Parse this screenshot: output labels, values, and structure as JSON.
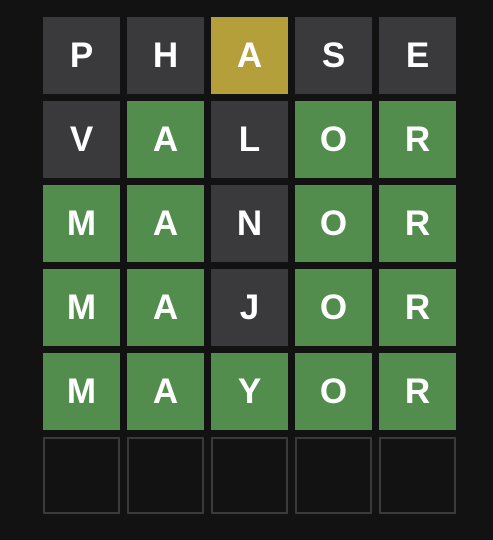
{
  "board": {
    "rows": [
      {
        "tiles": [
          {
            "letter": "P",
            "state": "absent"
          },
          {
            "letter": "H",
            "state": "absent"
          },
          {
            "letter": "A",
            "state": "present"
          },
          {
            "letter": "S",
            "state": "absent"
          },
          {
            "letter": "E",
            "state": "absent"
          }
        ]
      },
      {
        "tiles": [
          {
            "letter": "V",
            "state": "absent"
          },
          {
            "letter": "A",
            "state": "correct"
          },
          {
            "letter": "L",
            "state": "absent"
          },
          {
            "letter": "O",
            "state": "correct"
          },
          {
            "letter": "R",
            "state": "correct"
          }
        ]
      },
      {
        "tiles": [
          {
            "letter": "M",
            "state": "correct"
          },
          {
            "letter": "A",
            "state": "correct"
          },
          {
            "letter": "N",
            "state": "absent"
          },
          {
            "letter": "O",
            "state": "correct"
          },
          {
            "letter": "R",
            "state": "correct"
          }
        ]
      },
      {
        "tiles": [
          {
            "letter": "M",
            "state": "correct"
          },
          {
            "letter": "A",
            "state": "correct"
          },
          {
            "letter": "J",
            "state": "absent"
          },
          {
            "letter": "O",
            "state": "correct"
          },
          {
            "letter": "R",
            "state": "correct"
          }
        ]
      },
      {
        "tiles": [
          {
            "letter": "M",
            "state": "correct"
          },
          {
            "letter": "A",
            "state": "correct"
          },
          {
            "letter": "Y",
            "state": "correct"
          },
          {
            "letter": "O",
            "state": "correct"
          },
          {
            "letter": "R",
            "state": "correct"
          }
        ]
      },
      {
        "tiles": [
          {
            "letter": "",
            "state": "empty"
          },
          {
            "letter": "",
            "state": "empty"
          },
          {
            "letter": "",
            "state": "empty"
          },
          {
            "letter": "",
            "state": "empty"
          },
          {
            "letter": "",
            "state": "empty"
          }
        ]
      }
    ]
  },
  "colors": {
    "background": "#121213",
    "absent": "#3a3a3c",
    "present": "#b59f3b",
    "correct": "#538d4e",
    "empty_border": "#3a3a3c",
    "letter": "#ffffff"
  }
}
